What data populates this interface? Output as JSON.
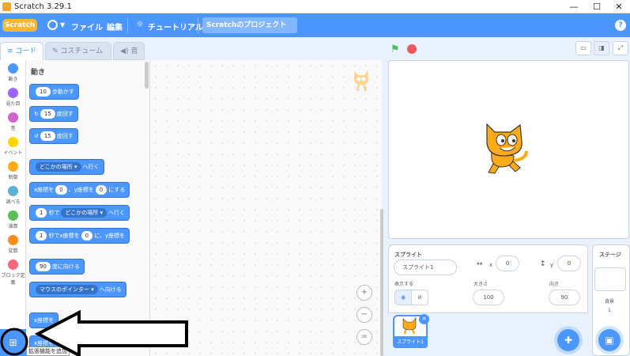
{
  "window": {
    "title": "Scratch 3.29.1",
    "minimize": "—",
    "maximize": "☐",
    "close": "✕"
  },
  "menubar": {
    "logo": "Scratch",
    "file": "ファイル",
    "edit": "編集",
    "tutorial": "チュートリアル",
    "project_title": "Scratchのプロジェクト",
    "help": "?"
  },
  "tabs": {
    "code": "コード",
    "costume": "コスチューム",
    "sound": "音"
  },
  "categories": [
    {
      "label": "動き",
      "color": "#4c97ff"
    },
    {
      "label": "見た目",
      "color": "#9966ff"
    },
    {
      "label": "音",
      "color": "#cf63cf"
    },
    {
      "label": "イベント",
      "color": "#ffd500"
    },
    {
      "label": "制御",
      "color": "#ffab19"
    },
    {
      "label": "調べる",
      "color": "#5cb1d6"
    },
    {
      "label": "演算",
      "color": "#59c059"
    },
    {
      "label": "変数",
      "color": "#ff8c1a"
    },
    {
      "label": "ブロック定義",
      "color": "#ff6680"
    }
  ],
  "palette": {
    "section": "動き",
    "move": {
      "value": "10",
      "text": "歩動かす"
    },
    "turn_right": {
      "value": "15",
      "text": "度回す"
    },
    "turn_left": {
      "value": "15",
      "text": "度回す"
    },
    "goto": {
      "dropdown": "どこかの場所",
      "text": "へ行く"
    },
    "goto_xy": {
      "xlabel": "x座標を",
      "x": "0",
      "ylabel": "、y座標を",
      "y": "0",
      "text": "にする"
    },
    "glide": {
      "secs": "1",
      "mid": "秒で",
      "dropdown": "どこかの場所",
      "text": "へ行く"
    },
    "glide_xy": {
      "secs": "1",
      "mid": "秒でx座標を",
      "x": "0",
      "ylabel": "に、y座標を"
    },
    "point_dir": {
      "value": "90",
      "text": "度に向ける"
    },
    "point_towards": {
      "dropdown": "マウスのポインター",
      "text": "へ向ける"
    },
    "change_x": {
      "text": "x座標を"
    },
    "set_x": {
      "text": "x座標を"
    }
  },
  "zoom": {
    "in": "+",
    "out": "−",
    "reset": "="
  },
  "sprite_info": {
    "sprite_label": "スプライト",
    "sprite_name": "スプライト1",
    "x_label": "x",
    "x": "0",
    "y_label": "y",
    "y": "0",
    "show_label": "表示する",
    "size_label": "大きさ",
    "size": "100",
    "direction_label": "向き",
    "direction": "90"
  },
  "sprite_list": {
    "thumb_label": "スプライト1"
  },
  "stage_panel": {
    "label": "ステージ",
    "backdrop_label": "背景",
    "backdrop_count": "1"
  },
  "tooltip": "拡張機能を追加"
}
